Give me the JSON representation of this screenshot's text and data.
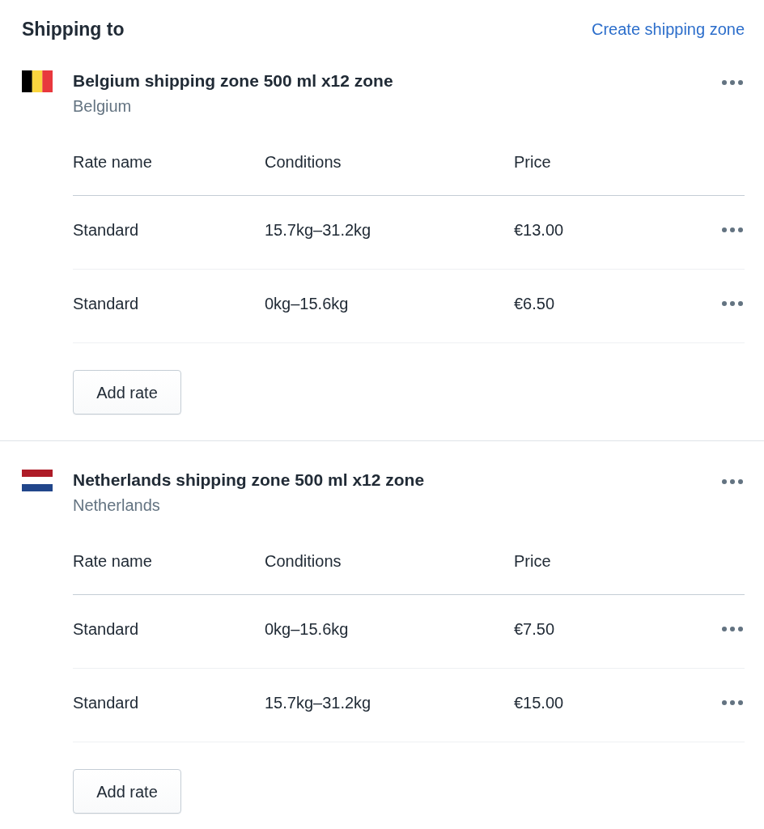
{
  "title": "Shipping to",
  "create_link": "Create shipping zone",
  "zones": [
    {
      "name": "Belgium shipping zone 500 ml x12 zone",
      "country": "Belgium",
      "flag": {
        "kind": "vertical",
        "stripes": [
          {
            "color": "#000000"
          },
          {
            "color": "#fad53f"
          },
          {
            "color": "#e8383d"
          }
        ]
      },
      "columns": [
        "Rate name",
        "Conditions",
        "Price"
      ],
      "rates": [
        {
          "rate_name": "Standard",
          "conditions": "15.7kg–31.2kg",
          "price": "€13.00"
        },
        {
          "rate_name": "Standard",
          "conditions": "0kg–15.6kg",
          "price": "€6.50"
        }
      ],
      "add_button": "Add rate"
    },
    {
      "name": "Netherlands shipping zone 500 ml x12 zone",
      "country": "Netherlands",
      "flag": {
        "kind": "horizontal",
        "stripes": [
          {
            "color": "#ae1c28"
          },
          {
            "color": "#ffffff"
          },
          {
            "color": "#21468b"
          }
        ]
      },
      "columns": [
        "Rate name",
        "Conditions",
        "Price"
      ],
      "rates": [
        {
          "rate_name": "Standard",
          "conditions": "0kg–15.6kg",
          "price": "€7.50"
        },
        {
          "rate_name": "Standard",
          "conditions": "15.7kg–31.2kg",
          "price": "€15.00"
        }
      ],
      "add_button": "Add rate"
    }
  ]
}
